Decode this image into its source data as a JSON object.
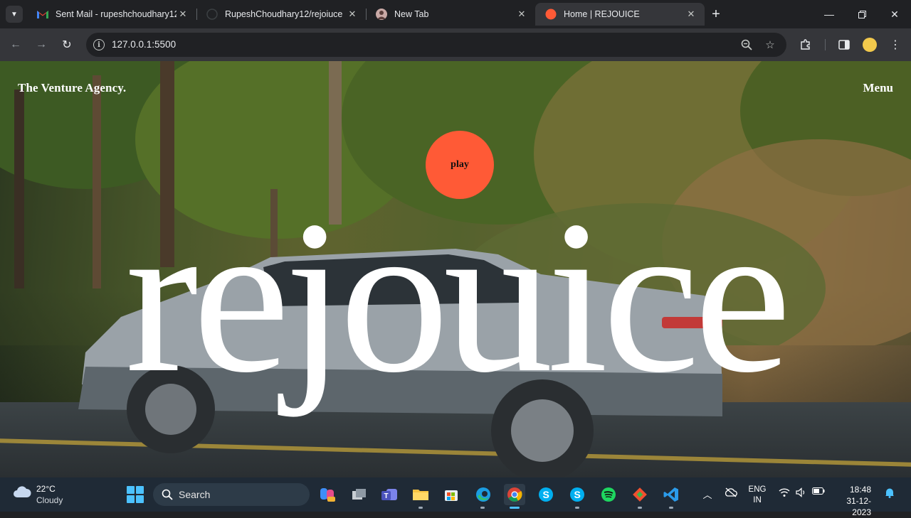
{
  "browser": {
    "tabs": [
      {
        "title": "Sent Mail - rupeshchoudhary12",
        "icon": "gmail-icon",
        "active": false
      },
      {
        "title": "RupeshChoudhary12/rejoiuce",
        "icon": "github-icon",
        "active": false
      },
      {
        "title": "New Tab",
        "icon": "profile-avatar-icon",
        "active": false
      },
      {
        "title": "Home | REJOUICE",
        "icon": "site-favicon-icon",
        "active": true
      }
    ],
    "address": "127.0.0.1:5500"
  },
  "page": {
    "brand": "The Venture Agency.",
    "menu": "Menu",
    "play": "play",
    "headline": "rejouice"
  },
  "taskbar": {
    "weather_temp": "22°C",
    "weather_condition": "Cloudy",
    "search_label": "Search",
    "language_line1": "ENG",
    "language_line2": "IN",
    "time": "18:48",
    "date": "31-12-2023"
  },
  "colors": {
    "play_button": "#ff5a36",
    "tab_strip": "#202124",
    "toolbar": "#35363a",
    "taskbar": "#1f2a36"
  }
}
